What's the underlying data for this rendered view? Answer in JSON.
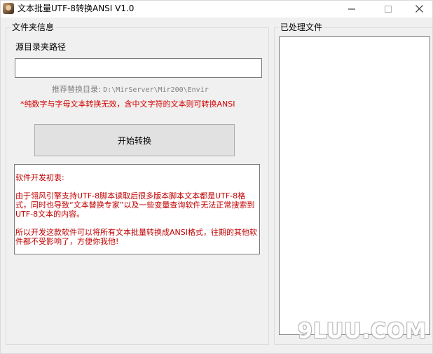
{
  "window": {
    "title": "文本批量UTF-8转换ANSI  V1.0"
  },
  "left_panel": {
    "group_title": "文件夹信息",
    "path_label": "源目录夹路径",
    "path_value": "",
    "hint_prefix": "推荐替换目录:",
    "hint_path": "D:\\MirServer\\Mir200\\Envir",
    "warning": "*纯数字与字母文本转换无效，含中文字符的文本则可转换ANSI",
    "start_button_label": "开始转换",
    "intro": {
      "heading": "软件开发初衷:",
      "paragraph1": "由于翎风引擎支持UTF-8脚本读取后很多版本脚本文本都是UTF-8格式，同时也导致“文本替换专家”以及一些变量查询软件无法正常搜索到UTF-8文本的内容。",
      "paragraph2": "所以开发这款软件可以将所有文本批量转换成ANSI格式，往期的其他软件都不受影响了，方便你我他!"
    }
  },
  "right_panel": {
    "group_title": "已处理文件",
    "items": []
  },
  "watermark": "9LUU.COM",
  "icons": {
    "app": "app-avatar-icon",
    "minimize": "minimize-icon",
    "maximize": "maximize-icon",
    "close": "close-icon"
  },
  "colors": {
    "warning_text": "#d40000",
    "intro_text": "#c00000",
    "hint_text": "#808080",
    "window_bg": "#f0f0f0"
  }
}
